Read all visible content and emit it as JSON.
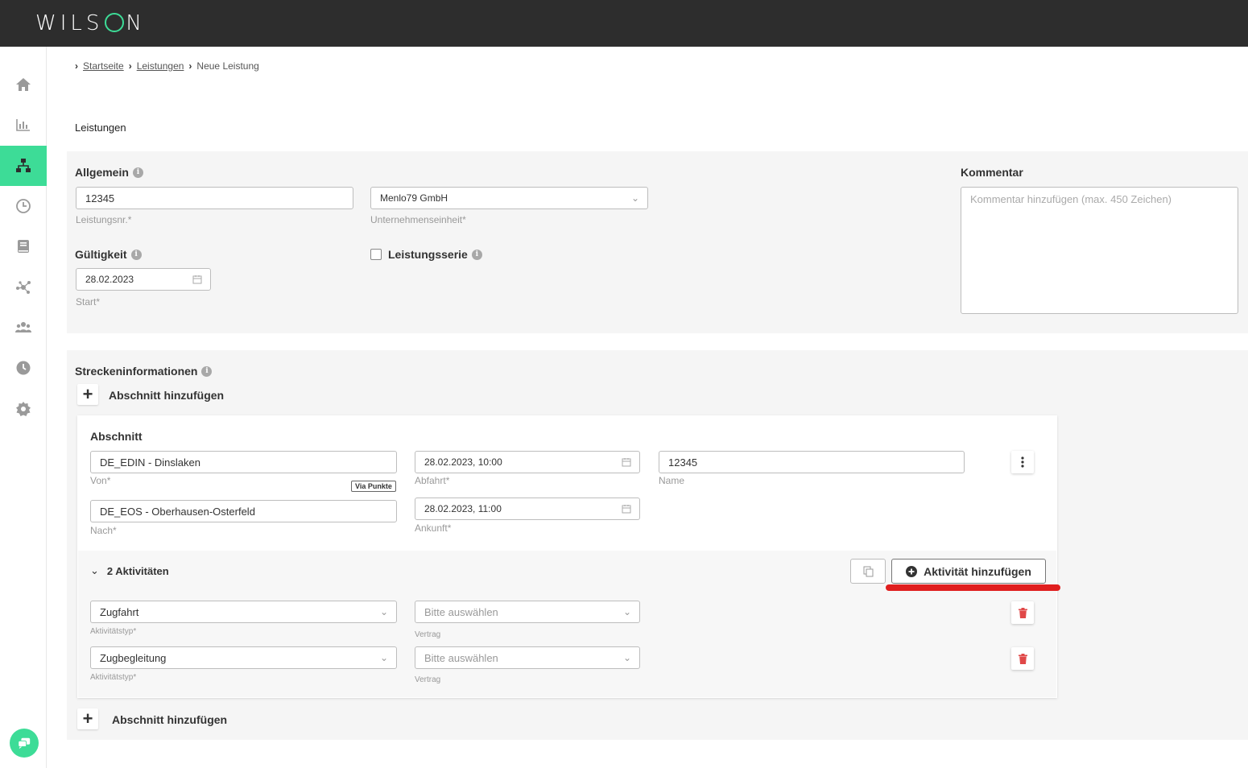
{
  "app": {
    "logo": "WILSON"
  },
  "breadcrumb": {
    "items": [
      "Startseite",
      "Leistungen",
      "Neue Leistung"
    ]
  },
  "page": {
    "title": "Leistungen"
  },
  "allgemein": {
    "title": "Allgemein",
    "leistungsnr_value": "12345",
    "leistungsnr_label": "Leistungsnr.*",
    "unternehmen_value": "Menlo79 GmbH",
    "unternehmen_label": "Unternehmenseinheit*"
  },
  "gueltigkeit": {
    "title": "Gültigkeit",
    "start_value": "28.02.2023",
    "start_label": "Start*"
  },
  "leistungsserie": {
    "label": "Leistungsserie"
  },
  "kommentar": {
    "title": "Kommentar",
    "placeholder": "Kommentar hinzufügen (max. 450 Zeichen)"
  },
  "strecke": {
    "title": "Streckeninformationen",
    "add_section_top": "Abschnitt hinzufügen",
    "add_section_bottom": "Abschnitt hinzufügen"
  },
  "abschnitt": {
    "title": "Abschnitt",
    "von_value": "DE_EDIN - Dinslaken",
    "von_label": "Von*",
    "via_badge": "Via Punkte",
    "nach_value": "DE_EOS - Oberhausen-Osterfeld",
    "nach_label": "Nach*",
    "abfahrt_value": "28.02.2023, 10:00",
    "abfahrt_label": "Abfahrt*",
    "ankunft_value": "28.02.2023, 11:00",
    "ankunft_label": "Ankunft*",
    "name_value": "12345",
    "name_label": "Name"
  },
  "aktivitaeten": {
    "toggle_label": "2 Aktivitäten",
    "add_label": "Aktivität hinzufügen",
    "rows": [
      {
        "typ": "Zugfahrt",
        "typ_label": "Aktivitätstyp*",
        "vertrag": "Bitte auswählen",
        "vertrag_label": "Vertrag"
      },
      {
        "typ": "Zugbegleitung",
        "typ_label": "Aktivitätstyp*",
        "vertrag": "Bitte auswählen",
        "vertrag_label": "Vertrag"
      }
    ]
  },
  "colors": {
    "accent": "#3ddc97",
    "topbar": "#2d2d2d",
    "highlight": "#e01e1e",
    "danger": "#e04848"
  }
}
